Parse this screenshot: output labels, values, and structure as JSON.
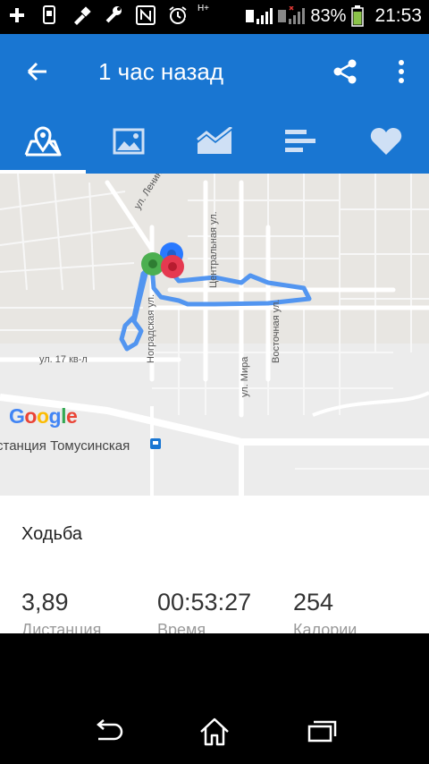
{
  "status_bar": {
    "battery_percent": "83%",
    "time": "21:53",
    "sim1_label": "1",
    "sim2_label": "2",
    "network_type": "H+"
  },
  "app_bar": {
    "title": "1 час назад"
  },
  "tabs": [
    {
      "icon": "map-icon",
      "selected": true
    },
    {
      "icon": "photo-icon",
      "selected": false
    },
    {
      "icon": "chart-icon",
      "selected": false
    },
    {
      "icon": "bars-icon",
      "selected": false
    },
    {
      "icon": "heart-icon",
      "selected": false
    }
  ],
  "map": {
    "streets": {
      "lenina": "ул. Ленина",
      "centralnaya": "Центральная ул.",
      "nogradskaya": "Ноградская ул.",
      "vostochnaya": "Восточная ул.",
      "mira": "ул. Мира",
      "kvl17": "ул. 17 кв-л"
    },
    "station": "станция Томусинская",
    "logo": "Google"
  },
  "activity": {
    "type": "Ходьба",
    "distance_value": "3,89",
    "distance_label": "Дистанция",
    "time_value": "00:53:27",
    "time_label": "Время",
    "calories_value": "254",
    "calories_label": "Калории"
  },
  "colors": {
    "primary": "#1976d2",
    "route": "#4a90f0",
    "start_marker": "#4caf50",
    "end_marker": "#e53950",
    "mid_marker": "#2979ff"
  }
}
